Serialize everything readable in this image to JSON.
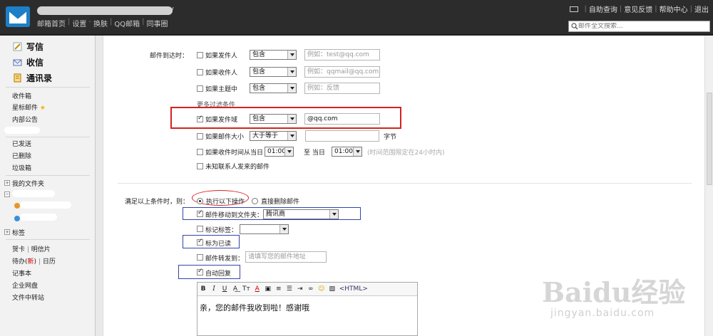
{
  "header": {
    "account_suffix": "/",
    "nav": [
      "邮箱首页",
      "设置",
      "换肤",
      "QQ邮箱",
      "同事圈"
    ],
    "links": [
      "自助查询",
      "意见反馈",
      "帮助中心",
      "退出"
    ],
    "search_placeholder": "邮件全文搜索..."
  },
  "sidebar": {
    "write": "写信",
    "receive": "收信",
    "contacts": "通讯录",
    "folders": [
      "收件箱",
      "星标邮件",
      "内部公告"
    ],
    "folders2": [
      "已发送",
      "已删除",
      "垃圾箱"
    ],
    "my_folders": "我的文件夹",
    "tags": "标签",
    "tools": [
      "贺卡",
      "明信片"
    ],
    "pending": "待办",
    "pending_new": "新",
    "calendar": "日历",
    "notes": "记事本",
    "netdisk": "企业网盘",
    "transfer": "文件中转站"
  },
  "form": {
    "arrive_label": "邮件到达时：",
    "if_sender": "如果发件人",
    "if_recipient": "如果收件人",
    "if_subject": "如果主题中",
    "more_conditions": "更多过滤条件",
    "if_sender_domain": "如果发件域",
    "if_size": "如果邮件大小",
    "if_time": "如果收件时间从当日",
    "to_day": "至 当日",
    "time_hint": "(时间范围限定在24小时内)",
    "unknown_contact": "未知联系人发来的邮件",
    "contains": "包含",
    "size_op": "大于等于",
    "bytes": "字节",
    "time_from": "01:00",
    "time_to": "01:00",
    "ph_sender": "例如：test@qq.com",
    "ph_recipient": "qqmail@qq.com",
    "ph_subject": "例如：反馈",
    "ph_recipient_prefix": "例如：",
    "domain_value": "@qq.com",
    "satisfy_label": "满足以上条件时，则：",
    "do_actions": "执行以下操作",
    "delete_direct": "直接删除邮件",
    "move_to": "邮件移动到文件夹：",
    "move_folder": "腾讯商",
    "mark_tag": "标记标签：",
    "mark_read": "标为已读",
    "forward_to": "邮件转发到：",
    "forward_ph": "请填写您的邮件地址",
    "auto_reply": "自动回复",
    "reply_text": "亲，您的邮件我收到啦！感谢哦",
    "html_btn": "<HTML>"
  },
  "watermark": {
    "brand": "Baidu经验",
    "url": "jingyan.baidu.com"
  },
  "colors": {
    "accent_red": "#d42222",
    "accent_blue": "#3344aa",
    "logo_blue": "#1d7fc8"
  }
}
